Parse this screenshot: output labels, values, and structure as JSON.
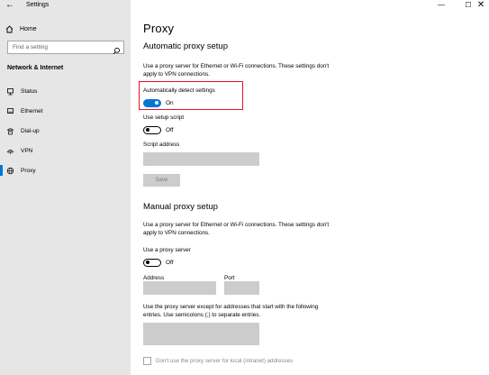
{
  "window": {
    "app_title": "Settings",
    "back_glyph": "←",
    "minimize_glyph": "—",
    "maximize_glyph": "☐",
    "close_glyph": "✕"
  },
  "sidebar": {
    "home_label": "Home",
    "home_icon": "home-icon",
    "search_placeholder": "Find a setting",
    "search_icon": "search-icon",
    "section_label": "Network & Internet",
    "items": [
      {
        "label": "Status",
        "icon": "status-icon"
      },
      {
        "label": "Ethernet",
        "icon": "ethernet-icon"
      },
      {
        "label": "Dial-up",
        "icon": "dialup-icon"
      },
      {
        "label": "VPN",
        "icon": "vpn-icon"
      },
      {
        "label": "Proxy",
        "icon": "proxy-icon",
        "active": true
      }
    ]
  },
  "main": {
    "title": "Proxy",
    "auto": {
      "heading": "Automatic proxy setup",
      "desc": "Use a proxy server for Ethernet or Wi-Fi connections. These settings don't apply to VPN connections.",
      "detect_label": "Automatically detect settings",
      "detect_state": "On",
      "script_label": "Use setup script",
      "script_state": "Off",
      "address_label": "Script address",
      "address_value": "",
      "save_label": "Save"
    },
    "manual": {
      "heading": "Manual proxy setup",
      "desc": "Use a proxy server for Ethernet or Wi-Fi connections. These settings don't apply to VPN connections.",
      "use_label": "Use a proxy server",
      "use_state": "Off",
      "address_label": "Address",
      "port_label": "Port",
      "address_value": "",
      "port_value": "",
      "exceptions_desc": "Use the proxy server except for addresses that start with the following entries. Use semicolons (;) to separate entries.",
      "exceptions_value": "",
      "local_label": "Don't use the proxy server for local (intranet) addresses"
    }
  },
  "colors": {
    "accent": "#0078d7",
    "highlight": "#e81123",
    "sidebar_bg": "#e6e6e6",
    "disabled_field": "#cccccc"
  }
}
